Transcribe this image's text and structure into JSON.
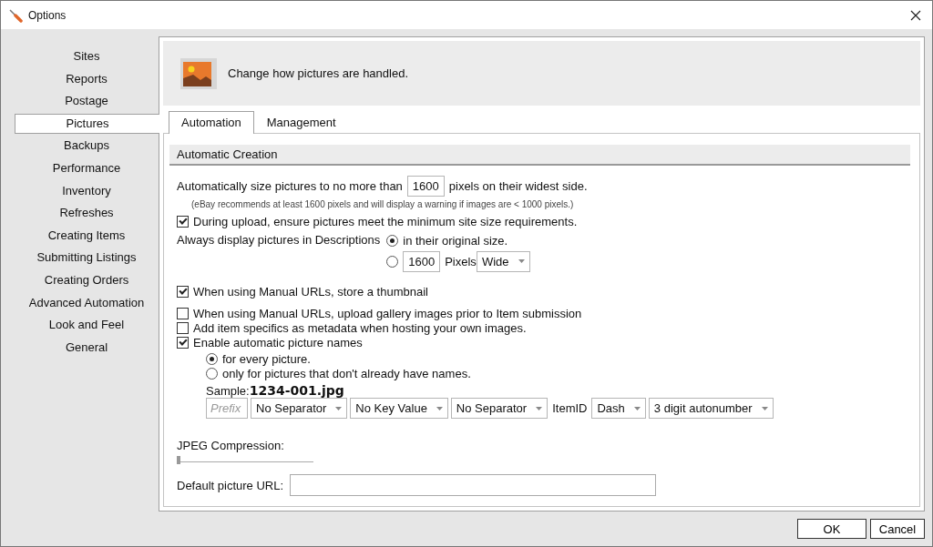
{
  "window": {
    "title": "Options"
  },
  "sidebar": {
    "items": [
      {
        "label": "Sites",
        "selected": false
      },
      {
        "label": "Reports",
        "selected": false
      },
      {
        "label": "Postage",
        "selected": false
      },
      {
        "label": "Pictures",
        "selected": true
      },
      {
        "label": "Backups",
        "selected": false
      },
      {
        "label": "Performance",
        "selected": false
      },
      {
        "label": "Inventory",
        "selected": false
      },
      {
        "label": "Refreshes",
        "selected": false
      },
      {
        "label": "Creating Items",
        "selected": false
      },
      {
        "label": "Submitting Listings",
        "selected": false
      },
      {
        "label": "Creating Orders",
        "selected": false
      },
      {
        "label": "Advanced Automation",
        "selected": false
      },
      {
        "label": "Look and Feel",
        "selected": false
      },
      {
        "label": "General",
        "selected": false
      }
    ]
  },
  "header": {
    "text": "Change how pictures are handled."
  },
  "tabs": [
    {
      "label": "Automation",
      "selected": true
    },
    {
      "label": "Management",
      "selected": false
    }
  ],
  "automatic_creation": {
    "title": "Automatic Creation",
    "size_limit": {
      "before": "Automatically size pictures to no more than",
      "value": "1600",
      "after": "pixels on their widest side."
    },
    "note": "(eBay recommends at least 1600 pixels and will display a warning if images are < 1000 pixels.)",
    "ensure_size": {
      "label": "During upload, ensure pictures meet the minimum site size requirements.",
      "checked": true
    },
    "display": {
      "label": "Always display pictures in Descriptions",
      "options": [
        {
          "kind": "plain",
          "label": "in their original size.",
          "selected": true
        },
        {
          "kind": "size",
          "value": "1600",
          "unit": "Pixels",
          "dropdown": "Wide",
          "selected": false
        }
      ]
    },
    "checkboxes": [
      {
        "label": "When using Manual URLs, store a thumbnail",
        "checked": true
      },
      {
        "label": "When using Manual URLs, upload gallery images prior to Item submission",
        "checked": false
      },
      {
        "label": "Add item specifics as metadata when hosting your own images.",
        "checked": false
      },
      {
        "label": "Enable automatic picture names",
        "checked": true
      }
    ],
    "name_options": [
      {
        "label": "for every picture.",
        "selected": true
      },
      {
        "label": "only for pictures that don't already have names.",
        "selected": false
      }
    ],
    "sample": {
      "label": "Sample:",
      "value": "1234-001.jpg"
    },
    "name_parts": [
      {
        "kind": "field",
        "placeholder": "Prefix"
      },
      {
        "kind": "dropdown",
        "value": "No Separator"
      },
      {
        "kind": "dropdown",
        "value": "No Key Value"
      },
      {
        "kind": "dropdown",
        "value": "No Separator"
      },
      {
        "kind": "text",
        "value": "ItemID"
      },
      {
        "kind": "dropdown",
        "value": "Dash"
      },
      {
        "kind": "dropdown",
        "value": "3 digit autonumber"
      }
    ],
    "jpeg": {
      "label": "JPEG Compression:",
      "level": 0
    },
    "url": {
      "label": "Default picture URL:"
    }
  },
  "buttons": [
    {
      "label": "OK"
    },
    {
      "label": "Cancel"
    }
  ]
}
